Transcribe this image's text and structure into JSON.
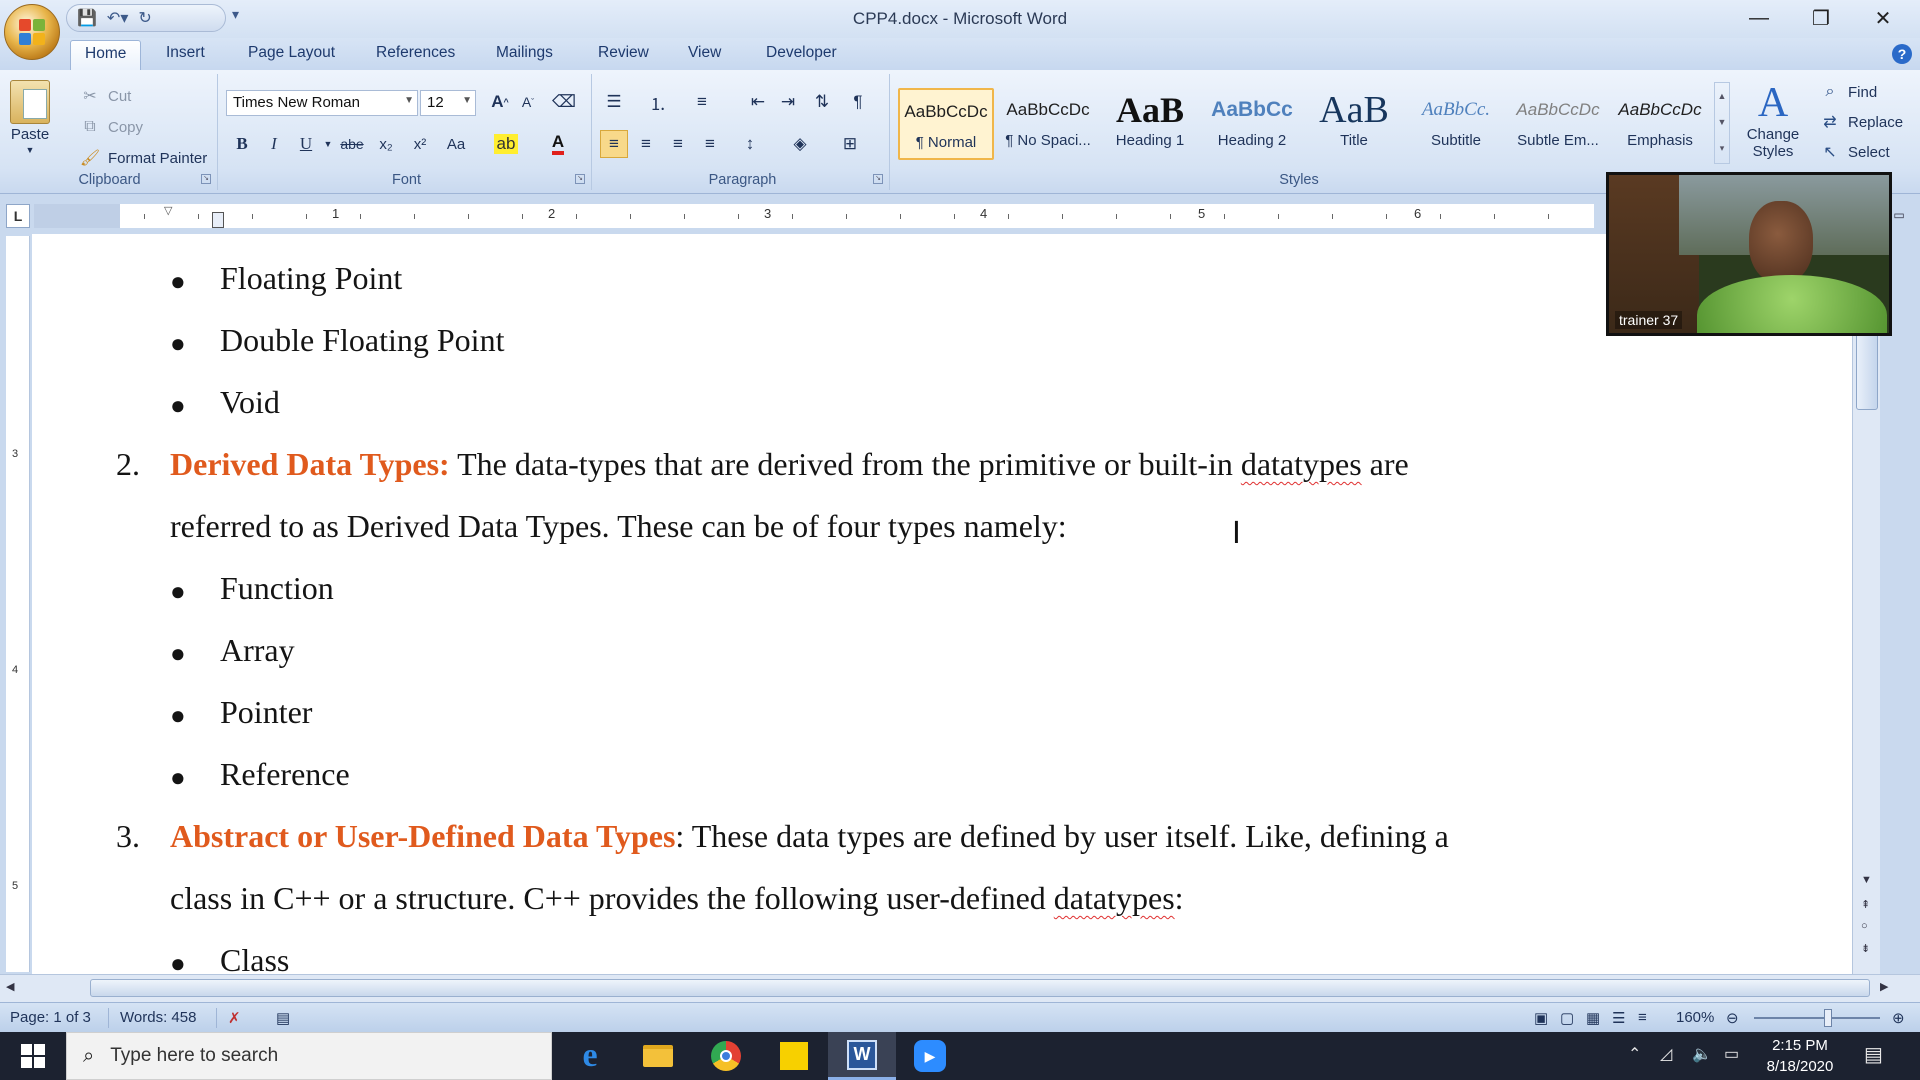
{
  "window": {
    "title": "CPP4.docx - Microsoft Word",
    "controls": {
      "minimize": "—",
      "restore": "❐",
      "close": "✕"
    }
  },
  "tabs": [
    "Home",
    "Insert",
    "Page Layout",
    "References",
    "Mailings",
    "Review",
    "View",
    "Developer"
  ],
  "ribbon": {
    "clipboard": {
      "label": "Clipboard",
      "paste": "Paste",
      "cut": "Cut",
      "copy": "Copy",
      "format_painter": "Format Painter"
    },
    "font": {
      "label": "Font",
      "font_name": "Times New Roman",
      "font_size": "12",
      "bold": "B",
      "italic": "I",
      "underline": "U",
      "strike": "abe",
      "subscript": "x₂",
      "superscript": "x²",
      "change_case": "Aa",
      "font_color": "A"
    },
    "paragraph": {
      "label": "Paragraph"
    },
    "styles": {
      "label": "Styles",
      "items": [
        {
          "preview": "AaBbCcDc",
          "name": "¶ Normal"
        },
        {
          "preview": "AaBbCcDc",
          "name": "¶ No Spaci..."
        },
        {
          "preview": "AaB",
          "name": "Heading 1"
        },
        {
          "preview": "AaBbCc",
          "name": "Heading 2"
        },
        {
          "preview": "AaB",
          "name": "Title"
        },
        {
          "preview": "AaBbCc.",
          "name": "Subtitle"
        },
        {
          "preview": "AaBbCcDc",
          "name": "Subtle Em..."
        },
        {
          "preview": "AaBbCcDc",
          "name": "Emphasis"
        }
      ],
      "change_styles": "Change Styles"
    },
    "editing": {
      "find": "Find",
      "replace": "Replace",
      "select": "Select"
    }
  },
  "ruler": {
    "numbers": [
      "1",
      "2",
      "3",
      "4",
      "5",
      "6"
    ],
    "tab_stop": "L",
    "vertical_numbers": [
      "3",
      "4",
      "5"
    ]
  },
  "document": {
    "bullets_top": [
      "Floating Point",
      "Double Floating Point",
      "Void"
    ],
    "item2": {
      "number": "2.",
      "heading": "Derived Data Types:",
      "line1_rest": " The data-types that are derived from the primitive or built-in ",
      "misspelled1": "datatypes",
      "line1_end": " are",
      "line2": "referred to as Derived Data Types. These can be of four types namely:"
    },
    "bullets_mid": [
      "Function",
      "Array",
      "Pointer",
      "Reference"
    ],
    "item3": {
      "number": "3.",
      "heading": "Abstract or User-Defined Data Types",
      "line1_rest": ": These data types are defined by user itself. Like, defining a",
      "line2_start": "class in C++ or a structure. C++ provides the following user-defined ",
      "misspelled2": "datatypes",
      "line2_end": ":"
    },
    "bullet_partial": "Class"
  },
  "status": {
    "page": "Page: 1 of 3",
    "words": "Words: 458",
    "zoom": "160%"
  },
  "taskbar": {
    "search_placeholder": "Type here to search",
    "time": "2:15 PM",
    "date": "8/18/2020"
  },
  "webcam": {
    "name": "trainer 37"
  },
  "colors": {
    "heading_accent": "#e05a1d",
    "ribbon_bg": "#d6e3f4",
    "taskbar_bg": "#1c2230"
  }
}
